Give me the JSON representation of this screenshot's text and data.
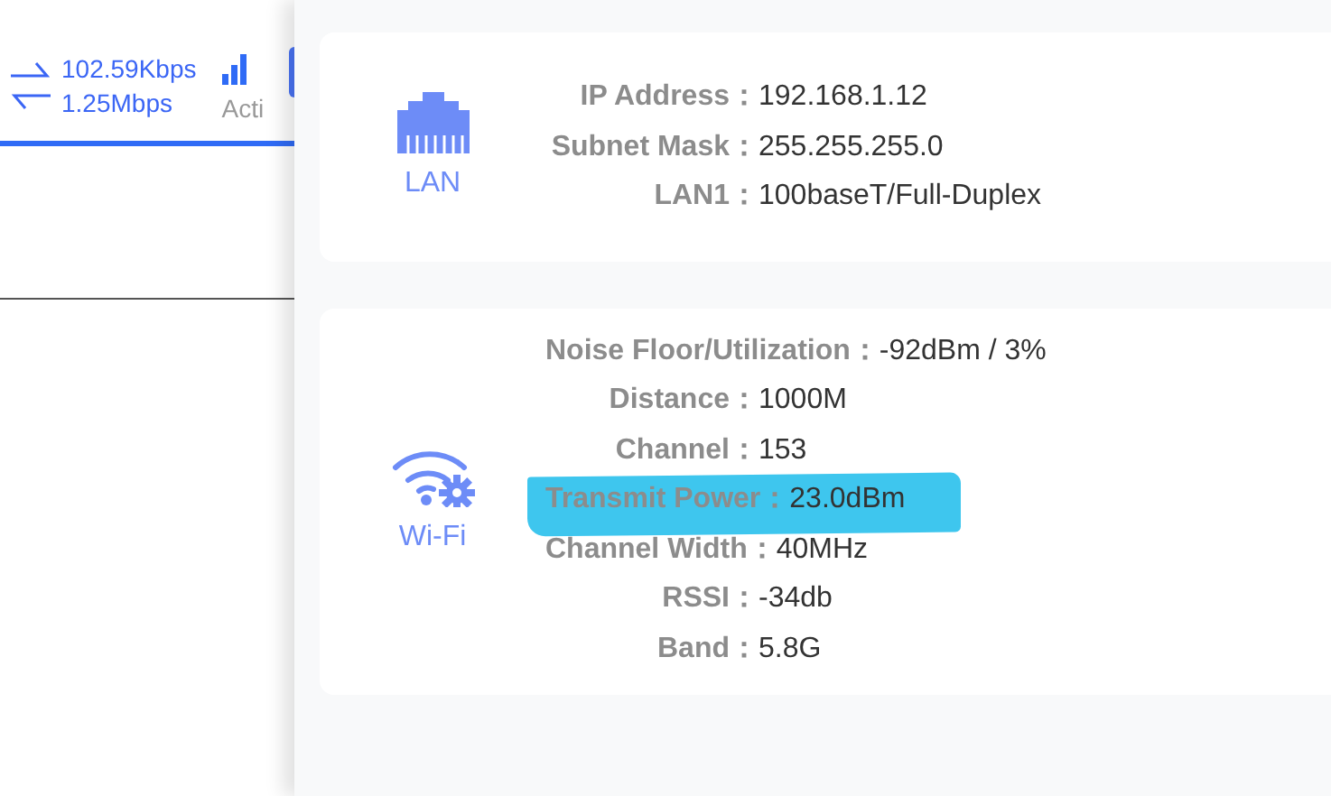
{
  "traffic": {
    "upload": "102.59Kbps",
    "download": "1.25Mbps",
    "status": "Acti"
  },
  "cards": [
    {
      "kind": "lan",
      "label": "LAN",
      "rows": [
        {
          "label": "IP Address：",
          "value": "192.168.1.12",
          "highlighted": false
        },
        {
          "label": "Subnet Mask：",
          "value": "255.255.255.0",
          "highlighted": false
        },
        {
          "label": "LAN1：",
          "value": "100baseT/Full-Duplex",
          "highlighted": false
        }
      ]
    },
    {
      "kind": "wifi",
      "label": "Wi-Fi",
      "rows": [
        {
          "label": "Noise Floor/Utilization：",
          "value": "-92dBm / 3%",
          "highlighted": false
        },
        {
          "label": "Distance：",
          "value": "1000M",
          "highlighted": false
        },
        {
          "label": "Channel：",
          "value": "153",
          "highlighted": false
        },
        {
          "label": "Transmit Power：",
          "value": "23.0dBm",
          "highlighted": true
        },
        {
          "label": "Channel Width：",
          "value": "40MHz",
          "highlighted": false
        },
        {
          "label": "RSSI：",
          "value": "-34db",
          "highlighted": false
        },
        {
          "label": "Band：",
          "value": "5.8G",
          "highlighted": false
        }
      ]
    }
  ]
}
